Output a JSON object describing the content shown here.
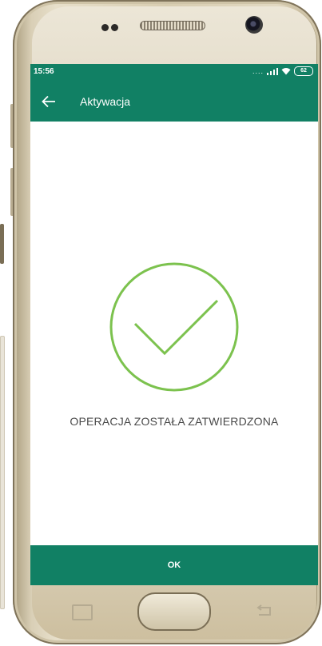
{
  "status_bar": {
    "time": "15:56",
    "signal_dots": "....",
    "battery": "62"
  },
  "app_bar": {
    "title": "Aktywacja",
    "back_icon": "arrow-left-icon"
  },
  "content": {
    "icon": "checkmark-circle-icon",
    "message": "OPERACJA ZOSTAŁA ZATWIERDZONA"
  },
  "ok_button": {
    "label": "OK"
  },
  "colors": {
    "brand_green": "#118064",
    "check_green": "#7cc24e",
    "text_gray": "#4a4a4a"
  },
  "device": {
    "nav_icons": [
      "recent-apps-icon",
      "home-button",
      "nav-back-icon"
    ]
  }
}
